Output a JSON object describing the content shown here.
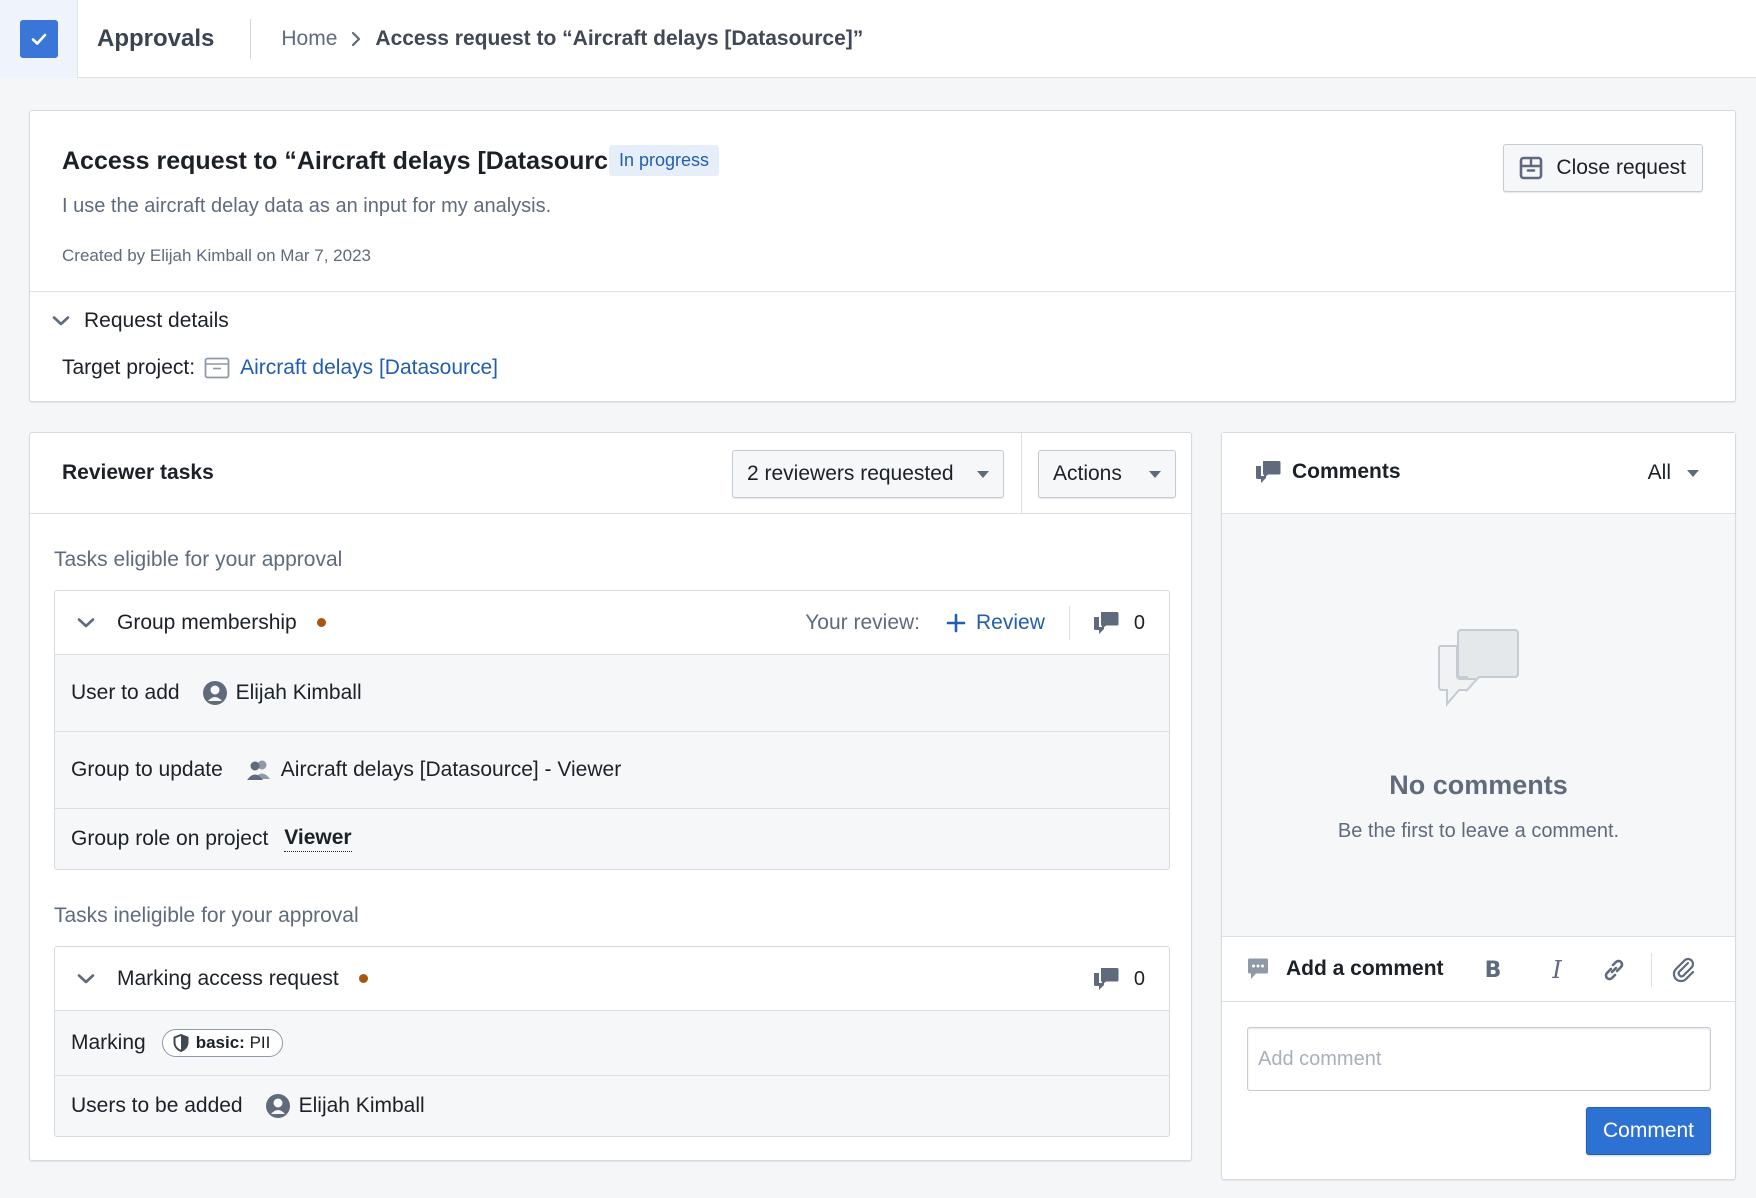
{
  "app": {
    "title": "Approvals",
    "icon": "checkbox-icon",
    "accent_color": "#3a76d8"
  },
  "breadcrumb": {
    "home": "Home",
    "current": "Access request to “Aircraft delays [Datasource]”"
  },
  "request": {
    "title": "Access request to “Aircraft delays [Datasource]”",
    "status": "In progress",
    "description": "I use the aircraft delay data as an input for my analysis.",
    "meta": "Created by Elijah Kimball on Mar 7, 2023",
    "close_button": "Close request",
    "details_label": "Request details",
    "target_label": "Target project:",
    "target_value": "Aircraft delays [Datasource]"
  },
  "tasks": {
    "title": "Reviewer tasks",
    "reviewers_dropdown": "2 reviewers requested",
    "actions_dropdown": "Actions",
    "eligible_label": "Tasks eligible for your approval",
    "ineligible_label": "Tasks ineligible for your approval",
    "eligible": [
      {
        "name": "Group membership",
        "status_color": "#a65612",
        "your_review_label": "Your review:",
        "review_button": "Review",
        "comment_count": "0",
        "rows": [
          {
            "label": "User to add",
            "value": "Elijah Kimball",
            "icon": "user-icon"
          },
          {
            "label": "Group to update",
            "value": "Aircraft delays [Datasource] - Viewer",
            "icon": "people-icon"
          },
          {
            "label": "Group role on project",
            "value": "Viewer"
          }
        ]
      }
    ],
    "ineligible": [
      {
        "name": "Marking access request",
        "status_color": "#a65612",
        "comment_count": "0",
        "rows": [
          {
            "label": "Marking",
            "tag_bold": "basic:",
            "tag_rest": " PII",
            "icon": "shield-icon"
          },
          {
            "label": "Users to be added",
            "value": "Elijah Kimball",
            "icon": "user-icon"
          }
        ]
      }
    ]
  },
  "comments": {
    "title": "Comments",
    "filter": "All",
    "empty_title": "No comments",
    "empty_subtitle": "Be the first to leave a comment.",
    "composer_title": "Add a comment",
    "input_placeholder": "Add comment",
    "input_value": "",
    "submit_button": "Comment"
  }
}
